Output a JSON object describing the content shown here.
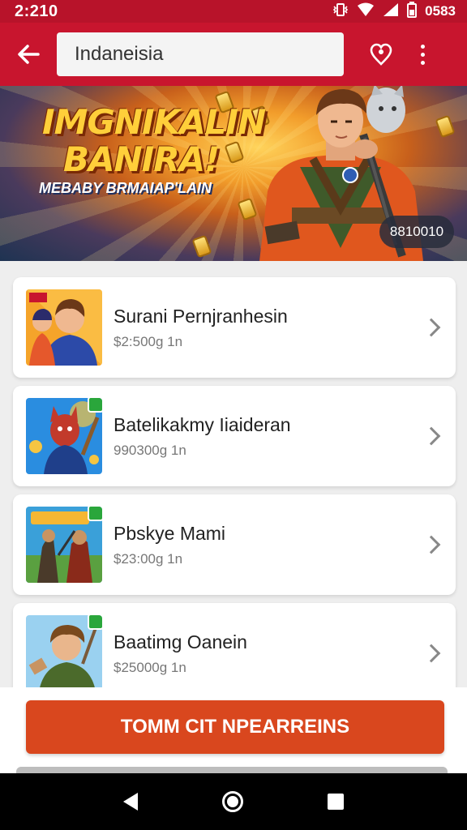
{
  "status_bar": {
    "time": "2:210",
    "battery_text": "0583"
  },
  "app_bar": {
    "search_value": "Indaneisia"
  },
  "banner": {
    "title_line1": "IMGNIKALIN",
    "title_line2": "BANIRA!",
    "subtitle": "MEBABY BRMAIAP'LAIN",
    "badge_text": "8810010"
  },
  "games": [
    {
      "title": "Surani Pernjranhesin",
      "price": "$2:500g 1n",
      "thumb_colors": [
        "#f7b733",
        "#e5582c",
        "#2c4aa8"
      ]
    },
    {
      "title": "Batelikakmy Iiaideran",
      "price": "990300g 1n",
      "thumb_colors": [
        "#2a8de0",
        "#c23a2b",
        "#f5c542"
      ]
    },
    {
      "title": "Pbskye Mami",
      "price": "$23:00g 1n",
      "thumb_colors": [
        "#3aa0d9",
        "#7a4a2a",
        "#5aa040"
      ]
    },
    {
      "title": "Baatimg Oanein",
      "price": "$25000g 1n",
      "thumb_colors": [
        "#9ad1f0",
        "#4b6a2b",
        "#c89462"
      ]
    }
  ],
  "cta": {
    "label": "TOMM CIT NPEARREINS"
  },
  "colors": {
    "app_bar": "#c8152e",
    "status_bar": "#b8132a",
    "cta": "#d9471e"
  }
}
